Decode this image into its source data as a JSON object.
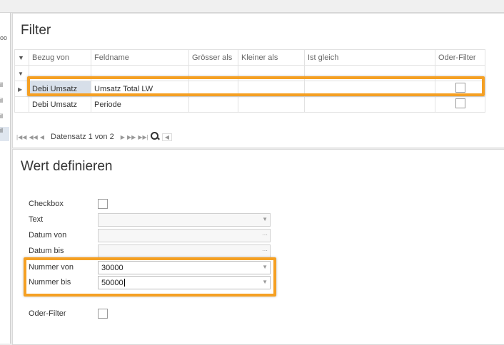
{
  "left_nav": {
    "tabs": [
      "oo",
      "il",
      "il",
      "il",
      "il"
    ]
  },
  "filter": {
    "title": "Filter",
    "columns": [
      "Bezug von",
      "Feldname",
      "Grösser als",
      "Kleiner als",
      "Ist gleich",
      "Oder-Filter"
    ],
    "rows": [
      {
        "bezug": "Debi Umsatz",
        "feldname": "Umsatz Total LW",
        "groesser": "",
        "kleiner": "",
        "gleich": "",
        "oder": false
      },
      {
        "bezug": "Debi Umsatz",
        "feldname": "Periode",
        "groesser": "",
        "kleiner": "",
        "gleich": "",
        "oder": false
      }
    ],
    "pager": {
      "record_text": "Datensatz 1 von 2"
    }
  },
  "wert": {
    "title": "Wert definieren",
    "checkbox_label": "Checkbox",
    "text_label": "Text",
    "datum_von_label": "Datum von",
    "datum_bis_label": "Datum bis",
    "nummer_von_label": "Nummer von",
    "nummer_von_value": "30000",
    "nummer_bis_label": "Nummer bis",
    "nummer_bis_value": "50000",
    "oder_filter_label": "Oder-Filter"
  },
  "colors": {
    "highlight": "#f5a023"
  }
}
